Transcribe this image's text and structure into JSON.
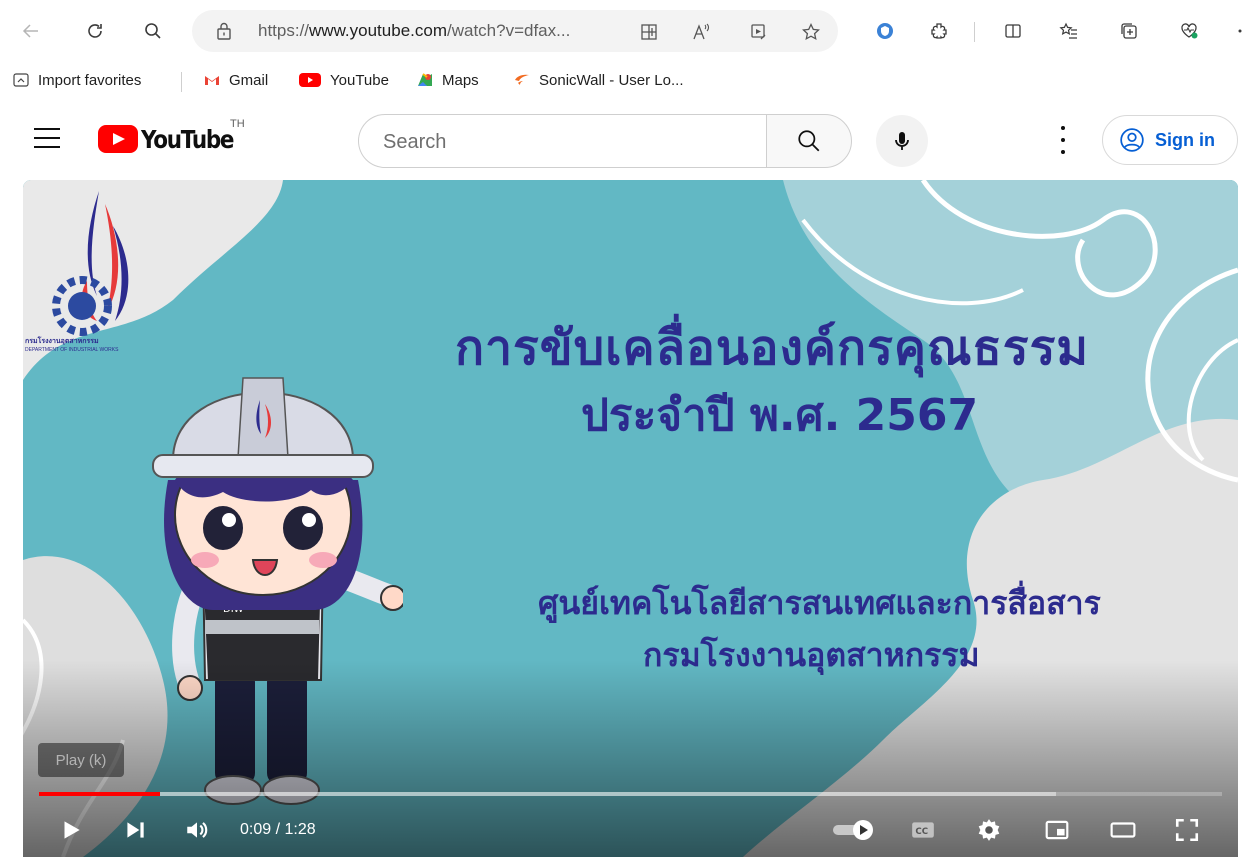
{
  "browser": {
    "url_prefix": "https://",
    "url_host": "www.youtube.com",
    "url_path": "/watch?v=dfax...",
    "icons": [
      "back-icon",
      "refresh-icon",
      "search-icon",
      "lock-icon",
      "app-grid-icon",
      "read-aloud-icon",
      "media-icon",
      "favorite-star-icon",
      "extension-shield-icon",
      "copilot-icon",
      "split-screen-icon",
      "favorites-icon",
      "collections-icon",
      "health-icon",
      "more-icon"
    ]
  },
  "favorites": [
    {
      "label": "Import favorites",
      "icon": "import-icon"
    },
    {
      "label": "Gmail",
      "icon": "gmail-icon"
    },
    {
      "label": "YouTube",
      "icon": "youtube-icon"
    },
    {
      "label": "Maps",
      "icon": "maps-icon"
    },
    {
      "label": "SonicWall - User Lo...",
      "icon": "sonicwall-icon"
    }
  ],
  "youtube": {
    "logo_text": "YouTube",
    "region": "TH",
    "search_placeholder": "Search",
    "signin_label": "Sign in",
    "accent": "#ff0000",
    "link_color": "#065fd4"
  },
  "video": {
    "title_line1": "การขับเคลื่อนองค์กรคุณธรรม",
    "title_line2": "ประจำปี พ.ศ. 2567",
    "subtitle_line1": "ศูนย์เทคโนโลยีสารสนเทศและการสื่อสาร",
    "subtitle_line2": "กรมโรงงานอุตสาหกรรม",
    "logo_caption": "กรมโรงงานอุตสาหกรรม",
    "logo_caption_en": "DEPARTMENT OF INDUSTRIAL WORKS",
    "badge_text": "DIW",
    "tooltip": "Play (k)",
    "time": "0:09 / 1:28",
    "played_fraction": 0.1024,
    "loaded_fraction": 0.86,
    "text_color": "#2c2b8e"
  }
}
